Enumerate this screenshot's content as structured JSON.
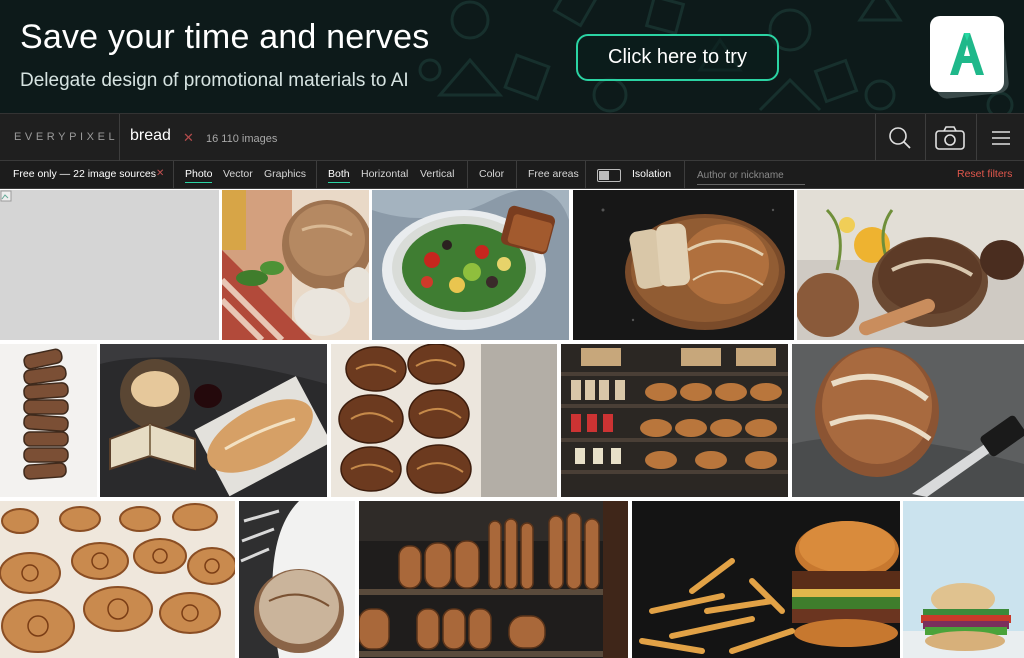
{
  "banner": {
    "title": "Save your time and nerves",
    "subtitle": "Delegate design of promotional materials to AI",
    "cta_label": "Click here to try",
    "logo_letter": "A",
    "colors": {
      "bg": "#0d1a1a",
      "accent": "#2bd3a3"
    }
  },
  "nav": {
    "logo": "EVERYPIXEL",
    "search_term": "bread",
    "clear_icon": "close-icon",
    "result_count": "16 110 images",
    "icons": [
      "search-icon",
      "camera-icon",
      "menu-icon"
    ]
  },
  "filters": {
    "free_only": "Free only — 22 image sources",
    "free_clear_icon": "close-icon",
    "types": [
      "Photo",
      "Vector",
      "Graphics"
    ],
    "orientation": [
      "Both",
      "Horizontal",
      "Vertical"
    ],
    "color": "Color",
    "free_areas": "Free areas",
    "isolation": "Isolation",
    "author_placeholder": "Author or nickname",
    "reset": "Reset filters",
    "accent": "#2bd3a3",
    "reset_color": "#e2574c"
  },
  "results": [
    {
      "name": "placeholder-image",
      "subject": "broken image"
    },
    {
      "name": "rustic-bread-garlic",
      "subject": "bread loaf with garlic"
    },
    {
      "name": "salad-bowl-bread",
      "subject": "salad with bread slices"
    },
    {
      "name": "sliced-loaf-board",
      "subject": "sliced sourdough on board"
    },
    {
      "name": "sourdough-flowers",
      "subject": "sourdough loaves with flowers"
    },
    {
      "name": "sliced-rye-loaf",
      "subject": "sliced rye bread"
    },
    {
      "name": "bread-book-wine",
      "subject": "bread, book and wine"
    },
    {
      "name": "braided-buns",
      "subject": "braided chocolate buns"
    },
    {
      "name": "bakery-shelves",
      "subject": "bakery shelves"
    },
    {
      "name": "sourdough-knife",
      "subject": "sourdough with knife"
    },
    {
      "name": "cinnamon-rolls",
      "subject": "cinnamon rolls on tray"
    },
    {
      "name": "round-loaf-towel",
      "subject": "round loaf on towel"
    },
    {
      "name": "baguettes-shelf",
      "subject": "baguettes on shelves"
    },
    {
      "name": "burger-fries",
      "subject": "burger with fries"
    },
    {
      "name": "sandwich",
      "subject": "sandwich"
    }
  ]
}
